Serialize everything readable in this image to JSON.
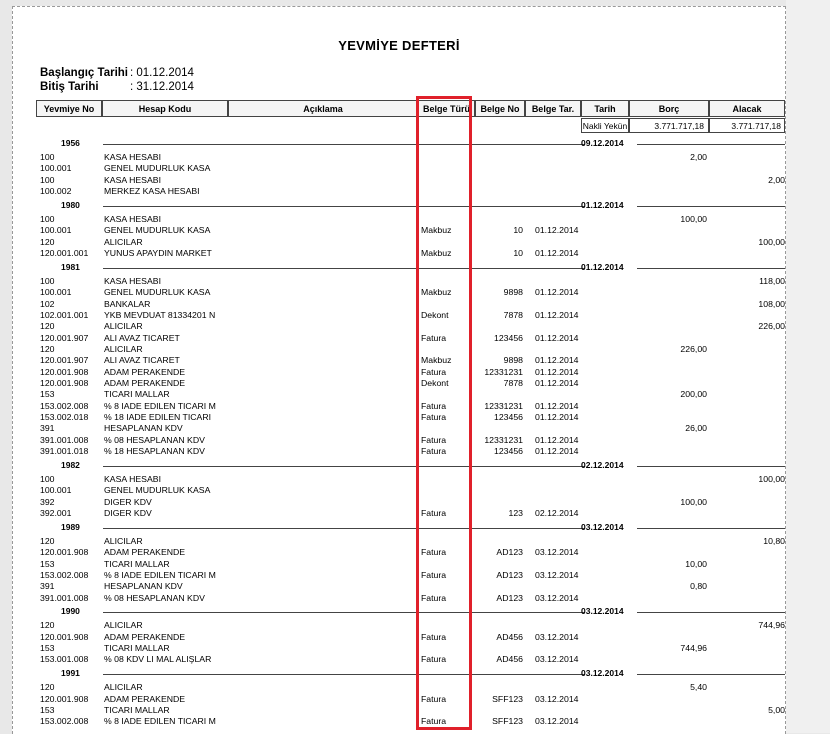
{
  "title": "YEVMİYE DEFTERİ",
  "meta": {
    "start_label": "Başlangıç Tarihi",
    "start_value": ": 01.12.2014",
    "end_label": "Bitiş Tarihi",
    "end_value": ": 31.12.2014"
  },
  "columns": [
    "Yevmiye No",
    "Hesap Kodu",
    "Açıklama",
    "Belge Türü",
    "Belge No",
    "Belge Tar.",
    "Tarih",
    "Borç",
    "Alacak"
  ],
  "nakli": {
    "label": "Nakli Yekün",
    "borc": "3.771.717,18",
    "alacak": "3.771.717,18"
  },
  "groups": [
    {
      "no": "1956",
      "date": "09.12.2014",
      "rows": [
        {
          "code": "100",
          "name": "KASA HESABI",
          "type": "",
          "bno": "",
          "bdate": "",
          "borc": "2,00",
          "alacak": ""
        },
        {
          "code": "100.001",
          "name": "GENEL MUDURLUK KASA",
          "type": "",
          "bno": "",
          "bdate": "",
          "borc": "",
          "alacak": ""
        },
        {
          "code": "100",
          "name": "KASA HESABI",
          "type": "",
          "bno": "",
          "bdate": "",
          "borc": "",
          "alacak": "2,00"
        },
        {
          "code": "100.002",
          "name": "MERKEZ KASA HESABI",
          "type": "",
          "bno": "",
          "bdate": "",
          "borc": "",
          "alacak": ""
        }
      ]
    },
    {
      "no": "1980",
      "date": "01.12.2014",
      "rows": [
        {
          "code": "100",
          "name": "KASA HESABI",
          "type": "",
          "bno": "",
          "bdate": "",
          "borc": "100,00",
          "alacak": ""
        },
        {
          "code": "100.001",
          "name": "GENEL MUDURLUK KASA",
          "type": "Makbuz",
          "bno": "10",
          "bdate": "01.12.2014",
          "borc": "",
          "alacak": ""
        },
        {
          "code": "120",
          "name": "ALICILAR",
          "type": "",
          "bno": "",
          "bdate": "",
          "borc": "",
          "alacak": "100,00"
        },
        {
          "code": "120.001.001",
          "name": "YUNUS APAYDIN MARKET",
          "type": "Makbuz",
          "bno": "10",
          "bdate": "01.12.2014",
          "borc": "",
          "alacak": ""
        }
      ]
    },
    {
      "no": "1981",
      "date": "01.12.2014",
      "rows": [
        {
          "code": "100",
          "name": "KASA HESABI",
          "type": "",
          "bno": "",
          "bdate": "",
          "borc": "",
          "alacak": "118,00"
        },
        {
          "code": "100.001",
          "name": "GENEL MUDURLUK KASA",
          "type": "Makbuz",
          "bno": "9898",
          "bdate": "01.12.2014",
          "borc": "",
          "alacak": ""
        },
        {
          "code": "102",
          "name": "BANKALAR",
          "type": "",
          "bno": "",
          "bdate": "",
          "borc": "",
          "alacak": "108,00"
        },
        {
          "code": "102.001.001",
          "name": "YKB MEVDUAT 81334201 N",
          "type": "Dekont",
          "bno": "7878",
          "bdate": "01.12.2014",
          "borc": "",
          "alacak": ""
        },
        {
          "code": "120",
          "name": "ALICILAR",
          "type": "",
          "bno": "",
          "bdate": "",
          "borc": "",
          "alacak": "226,00"
        },
        {
          "code": "120.001.907",
          "name": "ALI AVAZ TICARET",
          "type": "Fatura",
          "bno": "123456",
          "bdate": "01.12.2014",
          "borc": "",
          "alacak": ""
        },
        {
          "code": "120",
          "name": "ALICILAR",
          "type": "",
          "bno": "",
          "bdate": "",
          "borc": "226,00",
          "alacak": ""
        },
        {
          "code": "120.001.907",
          "name": "ALI AVAZ TICARET",
          "type": "Makbuz",
          "bno": "9898",
          "bdate": "01.12.2014",
          "borc": "",
          "alacak": ""
        },
        {
          "code": "120.001.908",
          "name": "ADAM PERAKENDE",
          "type": "Fatura",
          "bno": "12331231",
          "bdate": "01.12.2014",
          "borc": "",
          "alacak": ""
        },
        {
          "code": "120.001.908",
          "name": "ADAM PERAKENDE",
          "type": "Dekont",
          "bno": "7878",
          "bdate": "01.12.2014",
          "borc": "",
          "alacak": ""
        },
        {
          "code": "153",
          "name": "TICARI MALLAR",
          "type": "",
          "bno": "",
          "bdate": "",
          "borc": "200,00",
          "alacak": ""
        },
        {
          "code": "153.002.008",
          "name": "% 8 IADE EDILEN TICARI M",
          "type": "Fatura",
          "bno": "12331231",
          "bdate": "01.12.2014",
          "borc": "",
          "alacak": ""
        },
        {
          "code": "153.002.018",
          "name": "% 18 IADE EDILEN TICARI",
          "type": "Fatura",
          "bno": "123456",
          "bdate": "01.12.2014",
          "borc": "",
          "alacak": ""
        },
        {
          "code": "391",
          "name": "HESAPLANAN KDV",
          "type": "",
          "bno": "",
          "bdate": "",
          "borc": "26,00",
          "alacak": ""
        },
        {
          "code": "391.001.008",
          "name": "% 08 HESAPLANAN KDV",
          "type": "Fatura",
          "bno": "12331231",
          "bdate": "01.12.2014",
          "borc": "",
          "alacak": ""
        },
        {
          "code": "391.001.018",
          "name": "% 18 HESAPLANAN KDV",
          "type": "Fatura",
          "bno": "123456",
          "bdate": "01.12.2014",
          "borc": "",
          "alacak": ""
        }
      ]
    },
    {
      "no": "1982",
      "date": "02.12.2014",
      "rows": [
        {
          "code": "100",
          "name": "KASA HESABI",
          "type": "",
          "bno": "",
          "bdate": "",
          "borc": "",
          "alacak": "100,00"
        },
        {
          "code": "100.001",
          "name": "GENEL MUDURLUK KASA",
          "type": "",
          "bno": "",
          "bdate": "",
          "borc": "",
          "alacak": ""
        },
        {
          "code": "392",
          "name": "DIGER KDV",
          "type": "",
          "bno": "",
          "bdate": "",
          "borc": "100,00",
          "alacak": ""
        },
        {
          "code": "392.001",
          "name": "DIGER KDV",
          "type": "Fatura",
          "bno": "123",
          "bdate": "02.12.2014",
          "borc": "",
          "alacak": ""
        }
      ]
    },
    {
      "no": "1989",
      "date": "03.12.2014",
      "rows": [
        {
          "code": "120",
          "name": "ALICILAR",
          "type": "",
          "bno": "",
          "bdate": "",
          "borc": "",
          "alacak": "10,80"
        },
        {
          "code": "120.001.908",
          "name": "ADAM PERAKENDE",
          "type": "Fatura",
          "bno": "AD123",
          "bdate": "03.12.2014",
          "borc": "",
          "alacak": ""
        },
        {
          "code": "153",
          "name": "TICARI MALLAR",
          "type": "",
          "bno": "",
          "bdate": "",
          "borc": "10,00",
          "alacak": ""
        },
        {
          "code": "153.002.008",
          "name": "% 8 IADE EDILEN TICARI M",
          "type": "Fatura",
          "bno": "AD123",
          "bdate": "03.12.2014",
          "borc": "",
          "alacak": ""
        },
        {
          "code": "391",
          "name": "HESAPLANAN KDV",
          "type": "",
          "bno": "",
          "bdate": "",
          "borc": "0,80",
          "alacak": ""
        },
        {
          "code": "391.001.008",
          "name": "% 08 HESAPLANAN KDV",
          "type": "Fatura",
          "bno": "AD123",
          "bdate": "03.12.2014",
          "borc": "",
          "alacak": ""
        }
      ]
    },
    {
      "no": "1990",
      "date": "03.12.2014",
      "rows": [
        {
          "code": "120",
          "name": "ALICILAR",
          "type": "",
          "bno": "",
          "bdate": "",
          "borc": "",
          "alacak": "744,96"
        },
        {
          "code": "120.001.908",
          "name": "ADAM PERAKENDE",
          "type": "Fatura",
          "bno": "AD456",
          "bdate": "03.12.2014",
          "borc": "",
          "alacak": ""
        },
        {
          "code": "153",
          "name": "TICARI MALLAR",
          "type": "",
          "bno": "",
          "bdate": "",
          "borc": "744,96",
          "alacak": ""
        },
        {
          "code": "153.001.008",
          "name": "% 08 KDV LI MAL ALIŞLAR",
          "type": "Fatura",
          "bno": "AD456",
          "bdate": "03.12.2014",
          "borc": "",
          "alacak": ""
        }
      ]
    },
    {
      "no": "1991",
      "date": "03.12.2014",
      "rows": [
        {
          "code": "120",
          "name": "ALICILAR",
          "type": "",
          "bno": "",
          "bdate": "",
          "borc": "5,40",
          "alacak": ""
        },
        {
          "code": "120.001.908",
          "name": "ADAM PERAKENDE",
          "type": "Fatura",
          "bno": "SFF123",
          "bdate": "03.12.2014",
          "borc": "",
          "alacak": ""
        },
        {
          "code": "153",
          "name": "TICARI MALLAR",
          "type": "",
          "bno": "",
          "bdate": "",
          "borc": "",
          "alacak": "5,00"
        },
        {
          "code": "153.002.008",
          "name": "% 8 IADE EDILEN TICARI M",
          "type": "Fatura",
          "bno": "SFF123",
          "bdate": "03.12.2014",
          "borc": "",
          "alacak": ""
        }
      ]
    }
  ]
}
